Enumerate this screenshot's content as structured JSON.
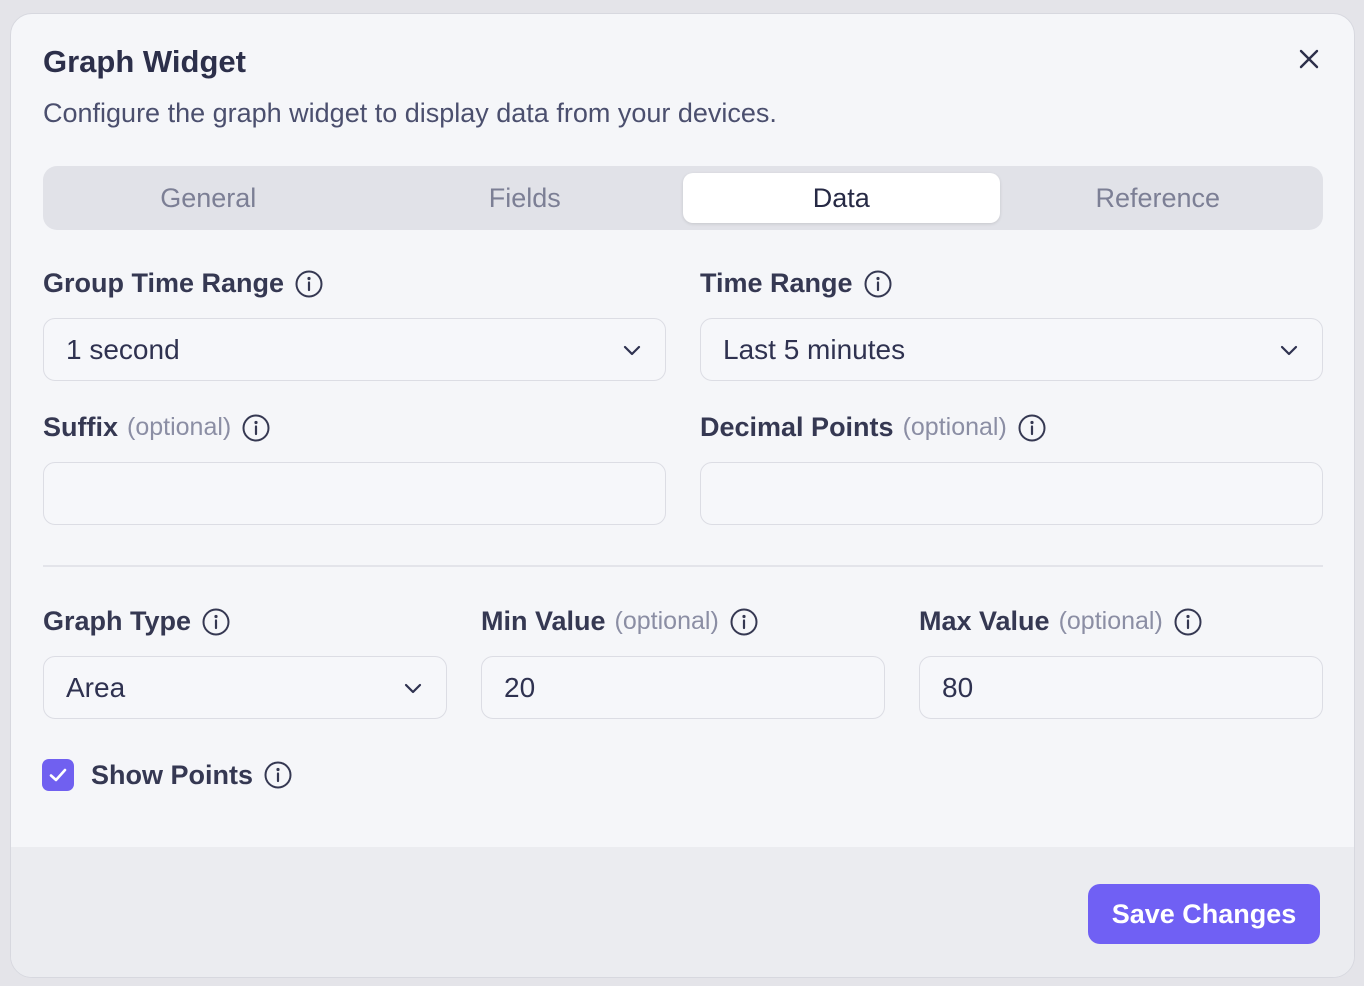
{
  "dialog": {
    "title": "Graph Widget",
    "subtitle": "Configure the graph widget to display data from your devices."
  },
  "tabs": [
    {
      "label": "General",
      "active": false
    },
    {
      "label": "Fields",
      "active": false
    },
    {
      "label": "Data",
      "active": true
    },
    {
      "label": "Reference",
      "active": false
    }
  ],
  "fields": {
    "group_time_range": {
      "label": "Group Time Range",
      "value": "1 second"
    },
    "time_range": {
      "label": "Time Range",
      "value": "Last 5 minutes"
    },
    "suffix": {
      "label": "Suffix",
      "optional": "(optional)",
      "value": ""
    },
    "decimal_points": {
      "label": "Decimal Points",
      "optional": "(optional)",
      "value": ""
    },
    "graph_type": {
      "label": "Graph Type",
      "value": "Area"
    },
    "min_value": {
      "label": "Min Value",
      "optional": "(optional)",
      "value": "20"
    },
    "max_value": {
      "label": "Max Value",
      "optional": "(optional)",
      "value": "80"
    }
  },
  "show_points": {
    "label": "Show Points",
    "checked": true
  },
  "footer": {
    "save_label": "Save Changes"
  },
  "icons": {
    "close": "close-icon",
    "info": "info-icon",
    "chevron": "chevron-down-icon",
    "check": "check-icon"
  },
  "colors": {
    "accent": "#7060f4",
    "background": "#f5f6f9",
    "footer": "#ebecf0"
  }
}
